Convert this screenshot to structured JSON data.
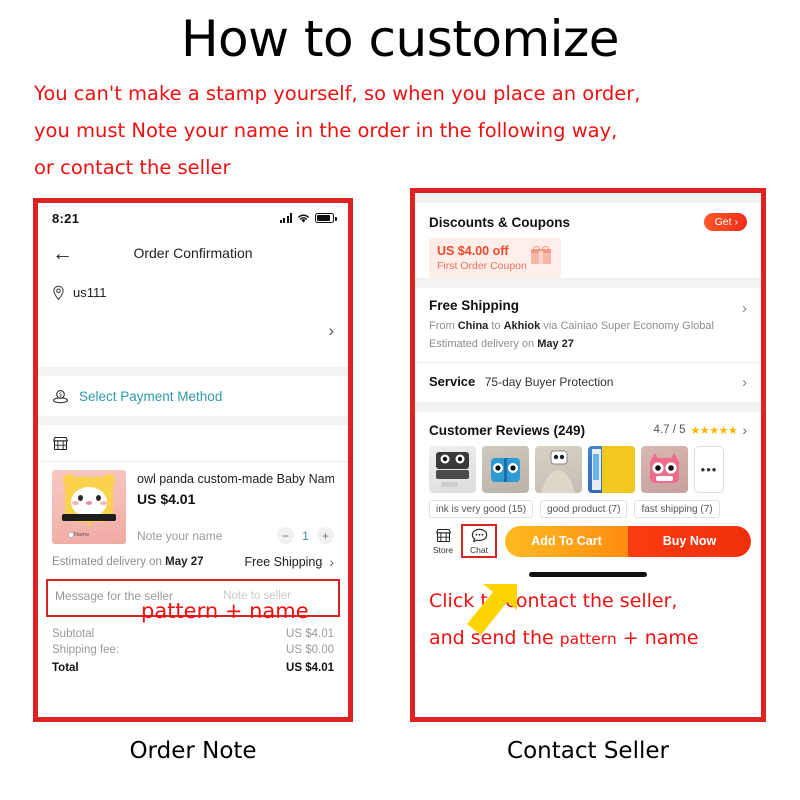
{
  "header": {
    "title": "How to customize",
    "intro_lines": [
      "You can't make a stamp yourself, so when you place an order,",
      "you must Note your name in the order in the following way,",
      "or contact the seller"
    ]
  },
  "left_panel": {
    "caption": "Order Note",
    "status_bar": {
      "time": "8:21",
      "signal_icon": "signal-bars-icon",
      "wifi_icon": "wifi-icon",
      "battery_icon": "battery-icon"
    },
    "nav": {
      "back_icon": "back-arrow-icon",
      "title": "Order Confirmation"
    },
    "address": {
      "pin_icon": "location-pin-icon",
      "name": "us111",
      "chevron": "›"
    },
    "payment": {
      "icon": "payment-method-icon",
      "label": "Select Payment Method"
    },
    "store": {
      "icon": "store-icon"
    },
    "product": {
      "image_alt": "shiba-stamp-photo",
      "title": "owl panda custom-made Baby Name S...",
      "price": "US $4.01",
      "note_placeholder": "Note your name",
      "qty": "1",
      "minus": "−",
      "plus": "+",
      "stamp_label": "Name"
    },
    "shipping": {
      "estimated_prefix": "Estimated delivery on ",
      "estimated_date": "May 27",
      "method": "Free Shipping",
      "chevron": "›"
    },
    "message_box": {
      "label": "Message for the seller",
      "placeholder": "Note to seller",
      "annotation": "pattern + name"
    },
    "totals": [
      {
        "label": "Subtotal",
        "value": "US $4.01"
      },
      {
        "label": "Shipping fee:",
        "value": "US $0.00"
      },
      {
        "label": "Total",
        "value": "US $4.01"
      }
    ]
  },
  "right_panel": {
    "caption": "Contact Seller",
    "coupons": {
      "title": "Discounts & Coupons",
      "get_label": "Get",
      "get_chevron": "›",
      "card_line1": "US $4.00 off",
      "card_line2": "First Order Coupon",
      "gift_icon": "gift-icon"
    },
    "shipping": {
      "title": "Free Shipping",
      "from_prefix": "From ",
      "from": "China",
      "to_prefix": " to ",
      "to": "Akhiok",
      "via": " via Cainiao Super Economy Global",
      "eta_prefix": "Estimated delivery on ",
      "eta_date": "May 27",
      "chevron": "›"
    },
    "service": {
      "title": "Service",
      "text": "75-day Buyer Protection",
      "chevron": "›"
    },
    "reviews": {
      "title": "Customer Reviews (249)",
      "score": "4.7 / 5",
      "stars": "★★★★★",
      "chevron": "›",
      "more_label": "•••",
      "thumbs": [
        "review-photo-panda-box",
        "review-photo-blue-stamp",
        "review-photo-sweater",
        "review-photo-yellow-package",
        "review-photo-pink-owl"
      ],
      "tags": [
        "ink is very good (15)",
        "good product (7)",
        "fast shipping (7)"
      ]
    },
    "bottom_bar": {
      "store_icon": "store-icon",
      "store_label": "Store",
      "chat_icon": "chat-bubble-icon",
      "chat_label": "Chat",
      "add_to_cart": "Add To Cart",
      "buy_now": "Buy Now",
      "arrow_icon": "yellow-arrow-icon"
    },
    "note": {
      "line1": "Click to contact the seller,",
      "line2_a": "and send the ",
      "line2_small": "pattern",
      "line2_b": " + name"
    }
  },
  "colors": {
    "red": "#dd2222",
    "annotation_red": "#ee1111",
    "teal": "#2f9aa8",
    "orange": "#ff8c10",
    "buy_red": "#f0300c",
    "star": "#ffb400",
    "arrow_yellow": "#ffd400"
  }
}
